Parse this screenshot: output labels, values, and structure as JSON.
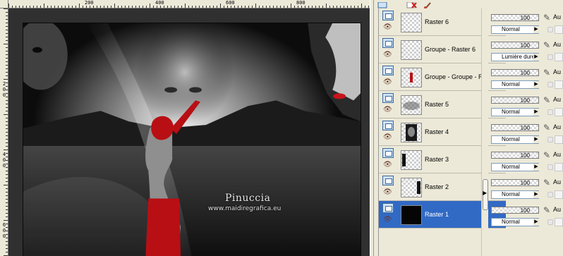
{
  "ruler": {
    "top_labels": [
      "200",
      "400",
      "600",
      "800"
    ],
    "left_labels": [
      "2",
      "0",
      "0",
      "4",
      "0",
      "0",
      "6",
      "0",
      "0"
    ]
  },
  "canvas": {
    "watermark_title": "Pinuccia",
    "watermark_url": "www.maidiregrafica.eu"
  },
  "layers_palette": {
    "toolbar_icons": [
      "new-layer-icon",
      "delete-layer-icon",
      "brush-icon"
    ],
    "layers": [
      {
        "name": "Raster 6",
        "opacity": "100",
        "blend": "Normal",
        "thumb": "transparent",
        "selected": false
      },
      {
        "name": "Groupe - Raster 6",
        "opacity": "100",
        "blend": "Lumière dure",
        "thumb": "transparent",
        "selected": false
      },
      {
        "name": "Groupe - Groupe - Ra",
        "opacity": "100",
        "blend": "Normal",
        "thumb": "figure",
        "selected": false
      },
      {
        "name": "Raster 5",
        "opacity": "100",
        "blend": "Normal",
        "thumb": "mist",
        "selected": false
      },
      {
        "name": "Raster 4",
        "opacity": "100",
        "blend": "Normal",
        "thumb": "face",
        "selected": false
      },
      {
        "name": "Raster 3",
        "opacity": "100",
        "blend": "Normal",
        "thumb": "dark-edge",
        "selected": false
      },
      {
        "name": "Raster 2",
        "opacity": "100",
        "blend": "Normal",
        "thumb": "dark-edge",
        "selected": false
      },
      {
        "name": "Raster 1",
        "opacity": "100",
        "blend": "Normal",
        "thumb": "black",
        "selected": true
      }
    ],
    "au_label": "Au"
  }
}
